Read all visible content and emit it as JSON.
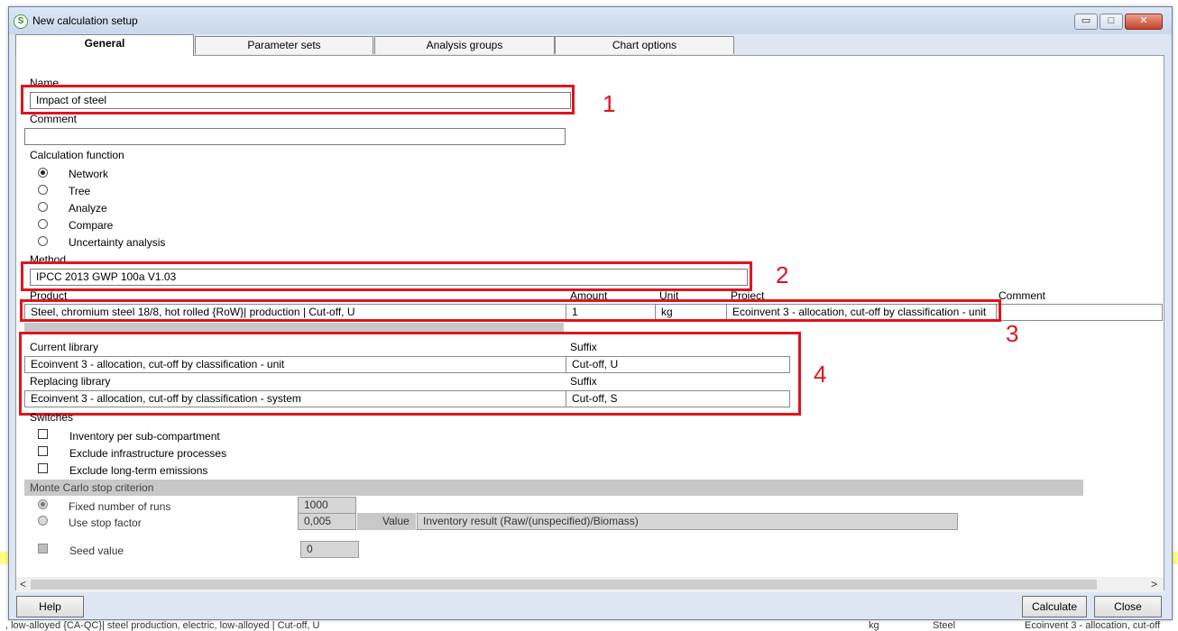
{
  "window": {
    "title": "New calculation setup",
    "app_icon_letter": "S",
    "minimize": "▭",
    "maximize": "□",
    "close": "✕"
  },
  "tabs": [
    {
      "label": "General"
    },
    {
      "label": "Parameter sets"
    },
    {
      "label": "Analysis groups"
    },
    {
      "label": "Chart options"
    }
  ],
  "general": {
    "name_label": "Name",
    "name_value": "Impact of steel",
    "comment_label": "Comment",
    "comment_value": "",
    "calc_function_label": "Calculation function",
    "calc_functions": [
      {
        "label": "Network",
        "selected": true
      },
      {
        "label": "Tree",
        "selected": false
      },
      {
        "label": "Analyze",
        "selected": false
      },
      {
        "label": "Compare",
        "selected": false
      },
      {
        "label": "Uncertainty analysis",
        "selected": false
      }
    ],
    "method_label": "Method",
    "method_value": "IPCC 2013 GWP 100a V1.03",
    "product_table": {
      "headers": {
        "product": "Product",
        "amount": "Amount",
        "unit": "Unit",
        "project": "Project",
        "comment": "Comment"
      },
      "row": {
        "product": "Steel, chromium steel 18/8, hot rolled {RoW}| production | Cut-off, U",
        "amount": "1",
        "unit": "kg",
        "project": "Ecoinvent 3 - allocation, cut-off by classification - unit",
        "comment": ""
      }
    },
    "library": {
      "current_label": "Current library",
      "suffix_label": "Suffix",
      "current_value": "Ecoinvent 3 - allocation, cut-off by classification - unit",
      "current_suffix": "Cut-off, U",
      "replacing_label": "Replacing library",
      "replacing_suffix_label": "Suffix",
      "replacing_value": "Ecoinvent 3 - allocation, cut-off by classification - system",
      "replacing_suffix": "Cut-off, S"
    },
    "switches_label": "Switches",
    "switches": [
      {
        "label": "Inventory per sub-compartment",
        "checked": false
      },
      {
        "label": "Exclude infrastructure processes",
        "checked": false
      },
      {
        "label": "Exclude long-term emissions",
        "checked": false
      }
    ],
    "monte_carlo": {
      "header": "Monte Carlo stop criterion",
      "fixed_runs_label": "Fixed number of runs",
      "fixed_runs_value": "1000",
      "stop_factor_label": "Use stop factor",
      "stop_factor_value": "0,005",
      "value_label": "Value",
      "value_field": "Inventory result (Raw/(unspecified)/Biomass)",
      "seed_label": "Seed value",
      "seed_value": "0"
    }
  },
  "annotations": {
    "a1": "1",
    "a2": "2",
    "a3": "3",
    "a4": "4"
  },
  "scrollbar": {
    "left_arrow": "<",
    "right_arrow": ">"
  },
  "buttons": {
    "help": "Help",
    "calculate": "Calculate",
    "close": "Close"
  },
  "background": {
    "bottom_row": [
      ", low-alloyed {CA-QC}| steel production, electric, low-alloyed | Cut-off, U",
      "kg",
      "Steel",
      "Ecoinvent 3 - allocation, cut-off"
    ]
  },
  "colors": {
    "annotation_red": "#e0141e",
    "window_bg": "#dde6f2"
  }
}
